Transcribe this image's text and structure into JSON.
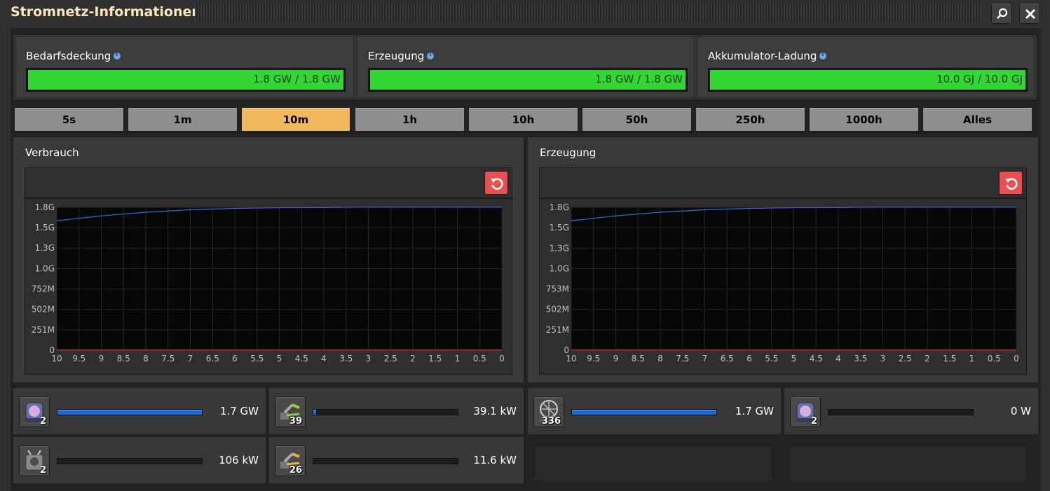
{
  "window": {
    "title": "Stromnetz-Informationen"
  },
  "stats": [
    {
      "label": "Bedarfsdeckung",
      "value": "1.8 GW / 1.8 GW",
      "fill": 1.0
    },
    {
      "label": "Erzeugung",
      "value": "1.8 GW / 1.8 GW",
      "fill": 1.0
    },
    {
      "label": "Akkumulator-Ladung",
      "value": "10.0 GJ / 10.0 GJ",
      "fill": 1.0
    }
  ],
  "time_buttons": [
    "5s",
    "1m",
    "10m",
    "1h",
    "10h",
    "50h",
    "250h",
    "1000h",
    "Alles"
  ],
  "active_time": "10m",
  "colors": {
    "accent_active": "#f0b75b",
    "bar_green": "#33d633",
    "line_blue": "#2b6fd6",
    "line_red": "#d43a2a",
    "reset_red": "#ea5050"
  },
  "panels": {
    "consumption": {
      "title": "Verbrauch"
    },
    "production": {
      "title": "Erzeugung"
    }
  },
  "chart_data": [
    {
      "type": "line",
      "title": "Verbrauch",
      "y_ticks": [
        "0",
        "251M",
        "502M",
        "752M",
        "1.0G",
        "1.3G",
        "1.5G",
        "1.8G"
      ],
      "y_tick_values": [
        0,
        251,
        502,
        752,
        1003,
        1254,
        1504,
        1755
      ],
      "x_ticks": [
        "10",
        "9.5",
        "9",
        "8.5",
        "8",
        "7.5",
        "7",
        "6.5",
        "6",
        "5.5",
        "5",
        "4.5",
        "4",
        "3.5",
        "3",
        "2.5",
        "2",
        "1.5",
        "1",
        "0.5",
        "0"
      ],
      "ylim": [
        0,
        1755
      ],
      "xlim": [
        10,
        0
      ],
      "series": [
        {
          "color": "#2b6fd6",
          "x": [
            10,
            9,
            8,
            7,
            6,
            5,
            4,
            3.5,
            3,
            2,
            1,
            0
          ],
          "y": [
            1590,
            1650,
            1695,
            1725,
            1742,
            1750,
            1752,
            1756,
            1757,
            1757,
            1757,
            1757
          ]
        },
        {
          "color": "#d43a2a",
          "x": [
            10,
            0
          ],
          "y": [
            2,
            2
          ]
        }
      ]
    },
    {
      "type": "line",
      "title": "Erzeugung",
      "y_ticks": [
        "0",
        "251M",
        "502M",
        "753M",
        "1.0G",
        "1.3G",
        "1.5G",
        "1.8G"
      ],
      "y_tick_values": [
        0,
        251,
        502,
        753,
        1004,
        1255,
        1506,
        1757
      ],
      "x_ticks": [
        "10",
        "9.5",
        "9",
        "8.5",
        "8",
        "7.5",
        "7",
        "6.5",
        "6",
        "5.5",
        "5",
        "4.5",
        "4",
        "3.5",
        "3",
        "2.5",
        "2",
        "1.5",
        "1",
        "0.5",
        "0"
      ],
      "ylim": [
        0,
        1757
      ],
      "xlim": [
        10,
        0
      ],
      "series": [
        {
          "color": "#2b6fd6",
          "x": [
            10,
            9,
            8,
            7,
            6,
            5,
            4,
            3.5,
            3,
            2,
            1,
            0
          ],
          "y": [
            1592,
            1652,
            1697,
            1727,
            1744,
            1752,
            1754,
            1758,
            1759,
            1759,
            1759,
            1759
          ]
        },
        {
          "color": "#d43a2a",
          "x": [
            10,
            0
          ],
          "y": [
            2,
            2
          ]
        }
      ]
    }
  ],
  "consumers": [
    {
      "icon": "lab-icon",
      "count": "2",
      "value": "1.7 GW",
      "fill": 1.0
    },
    {
      "icon": "inserter-green-icon",
      "count": "39",
      "value": "39.1 kW",
      "fill": 0.02
    },
    {
      "icon": "roboport-icon",
      "count": "2",
      "value": "106 kW",
      "fill": 0.0
    },
    {
      "icon": "inserter-yellow-icon",
      "count": "26",
      "value": "11.6 kW",
      "fill": 0.0
    }
  ],
  "producers": [
    {
      "icon": "steam-engine-icon",
      "count": "336",
      "value": "1.7 GW",
      "fill": 1.0
    },
    {
      "icon": "lab-icon",
      "count": "2",
      "value": "0 W",
      "fill": 0.0
    }
  ]
}
